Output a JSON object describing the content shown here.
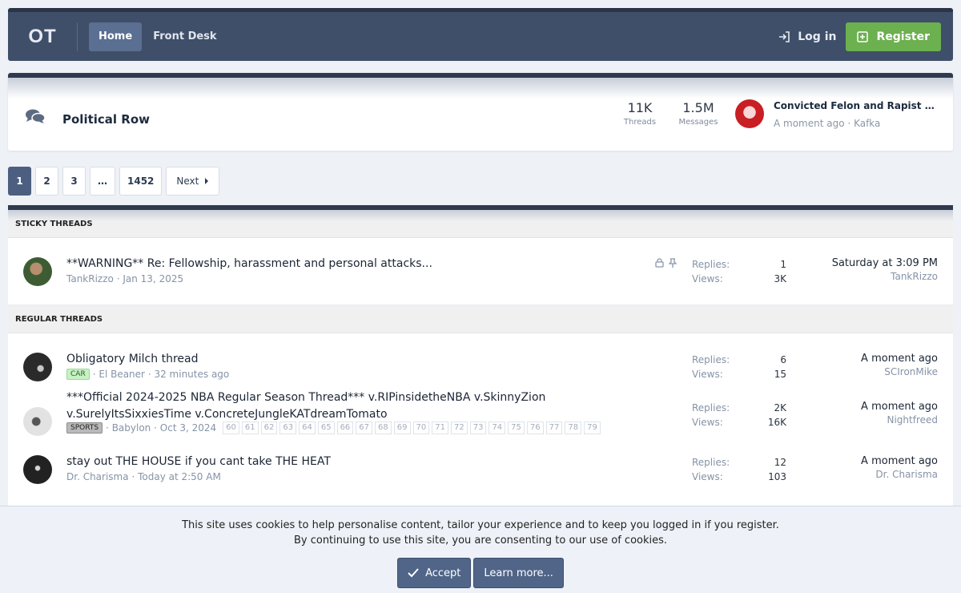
{
  "header": {
    "logo": "OT",
    "tabs": [
      {
        "label": "Home",
        "active": true
      },
      {
        "label": "Front Desk",
        "active": false
      }
    ],
    "login_label": "Log in",
    "register_label": "Register"
  },
  "forum": {
    "title": "Political Row",
    "threads_count": "11K",
    "threads_label": "Threads",
    "messages_count": "1.5M",
    "messages_label": "Messages",
    "latest_title": "Convicted Felon and Rapist Donald Trump",
    "latest_time": "A moment ago",
    "latest_user": "Kafka"
  },
  "pagination": {
    "pages": [
      "1",
      "2",
      "3",
      "…",
      "1452"
    ],
    "current": "1",
    "next_label": "Next"
  },
  "sections": {
    "sticky_label": "STICKY THREADS",
    "regular_label": "REGULAR THREADS"
  },
  "sticky_threads": [
    {
      "title": "**WARNING** Re: Fellowship, harassment and personal attacks...",
      "author": "TankRizzo",
      "date": "Jan 13, 2025",
      "replies": "1",
      "views": "3K",
      "last_time": "Saturday at 3:09 PM",
      "last_user": "TankRizzo"
    }
  ],
  "regular_threads": [
    {
      "title": "Obligatory Milch thread",
      "tag": "CAR",
      "author": "El Beaner",
      "date": "32 minutes ago",
      "replies": "6",
      "views": "15",
      "last_time": "A moment ago",
      "last_user": "SCIronMike"
    },
    {
      "title": "***Official 2024-2025 NBA Regular Season Thread*** v.RIPinsidetheNBA v.SkinnyZion v.SurelyItsSixxiesTime v.ConcreteJungleKATdreamTomato",
      "tag": "SPORTS",
      "author": "Babylon",
      "date": "Oct 3, 2024",
      "pages": [
        "60",
        "61",
        "62",
        "63",
        "64",
        "65",
        "66",
        "67",
        "68",
        "69",
        "70",
        "71",
        "72",
        "73",
        "74",
        "75",
        "76",
        "77",
        "78",
        "79"
      ],
      "replies": "2K",
      "views": "16K",
      "last_time": "A moment ago",
      "last_user": "Nightfreed"
    },
    {
      "title": "stay out THE HOUSE if you cant take THE HEAT",
      "author": "Dr. Charisma",
      "date": "Today at 2:50 AM",
      "replies": "12",
      "views": "103",
      "last_time": "A moment ago",
      "last_user": "Dr. Charisma"
    }
  ],
  "labels": {
    "replies": "Replies:",
    "views": "Views:",
    "sep": "·"
  },
  "cookie": {
    "line1": "This site uses cookies to help personalise content, tailor your experience and to keep you logged in if you register.",
    "line2": "By continuing to use this site, you are consenting to our use of cookies.",
    "accept_label": "Accept",
    "learn_label": "Learn more..."
  },
  "colors": {
    "header_bg": "#3f4f69",
    "register_green": "#6cb04f",
    "accent_blue": "#506588"
  }
}
